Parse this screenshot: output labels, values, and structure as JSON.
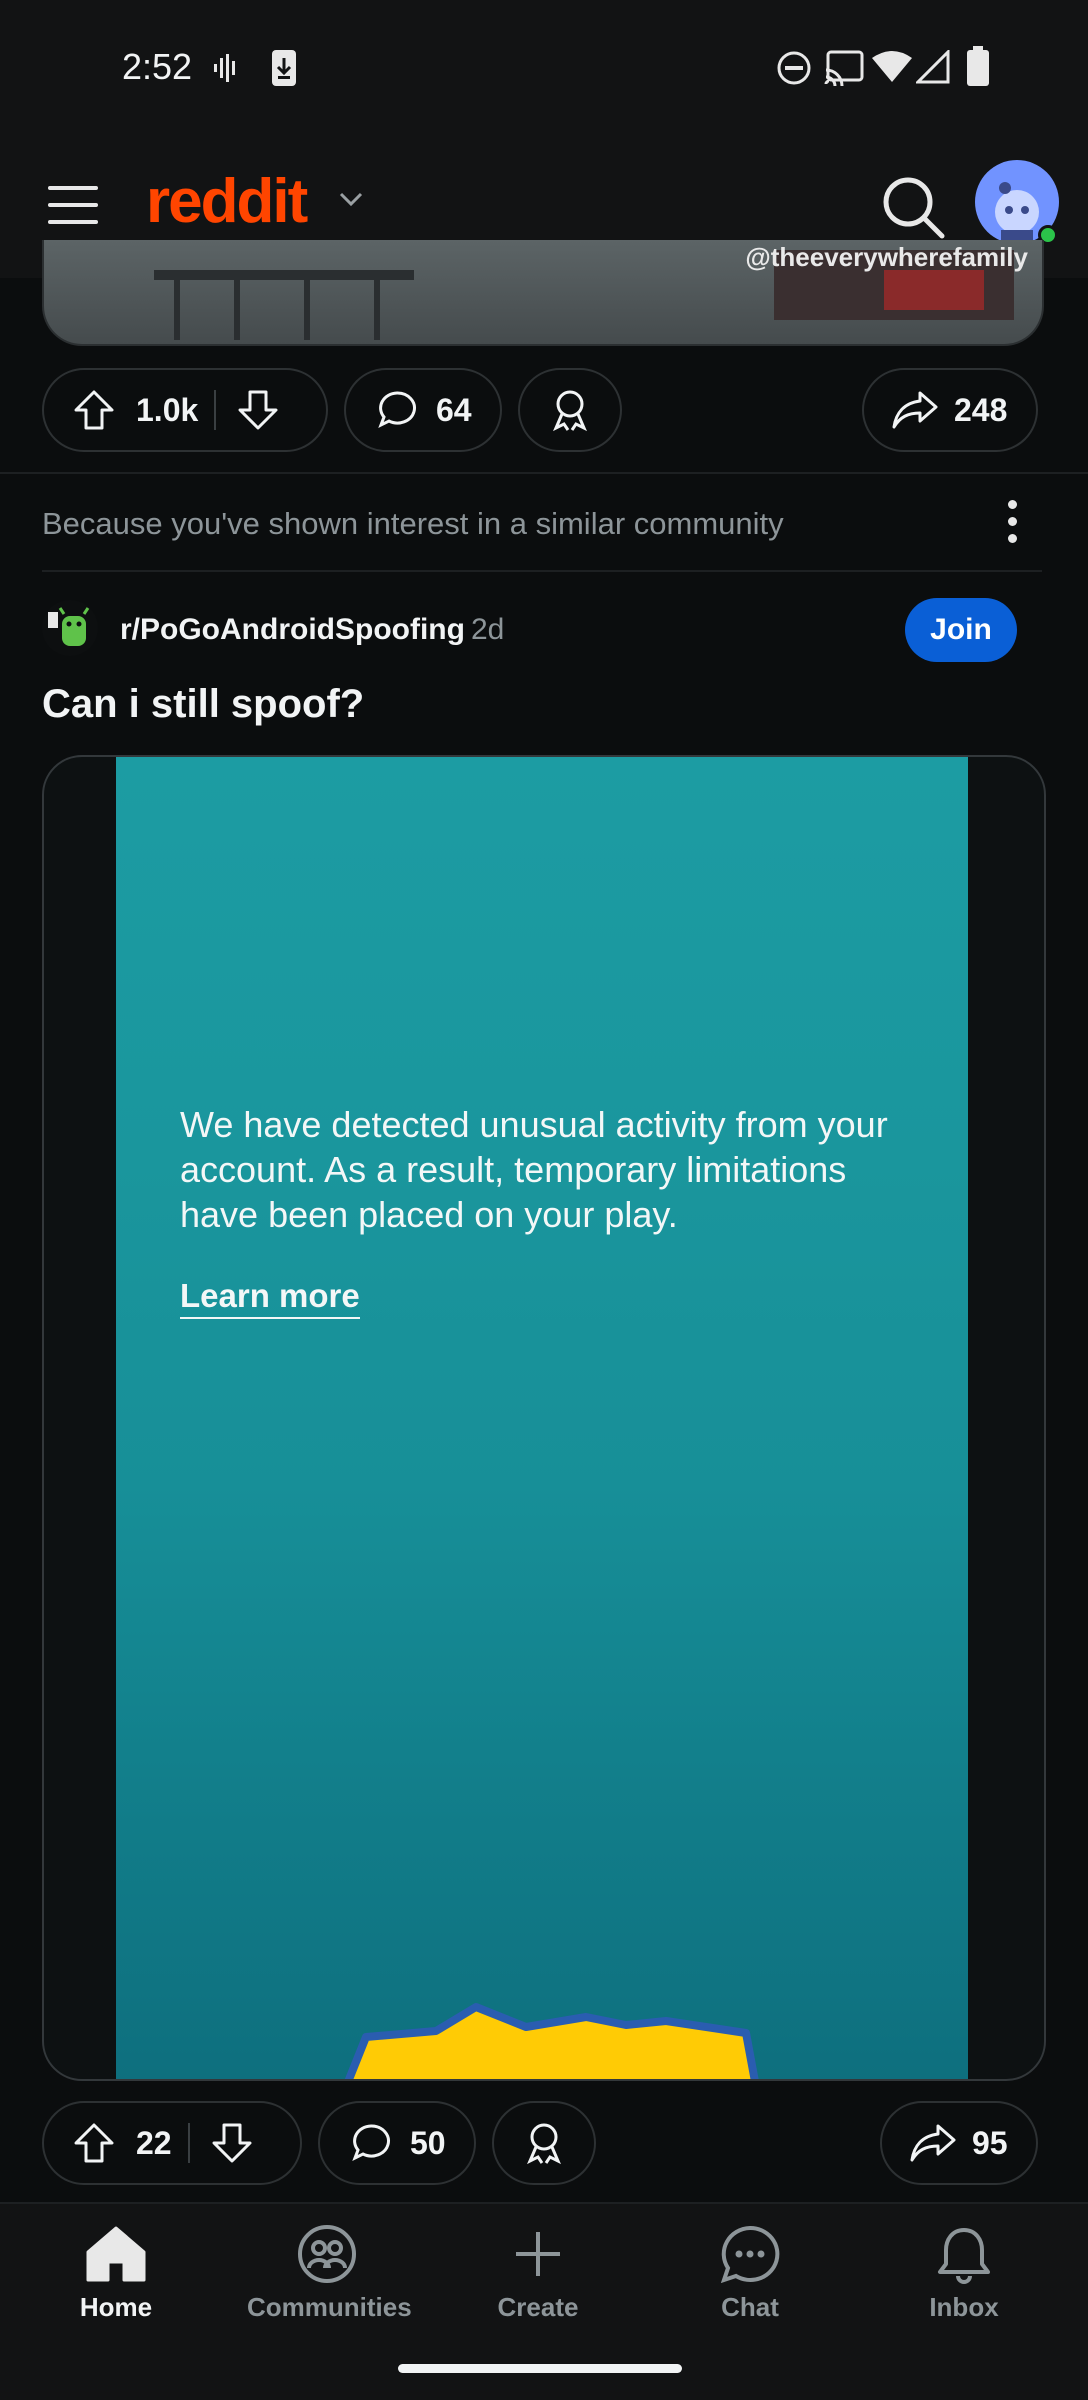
{
  "status_bar": {
    "time": "2:52",
    "icons": [
      "voicemail-icon",
      "download-icon",
      "do-not-disturb-icon",
      "cast-icon",
      "wifi-icon",
      "signal-icon",
      "battery-icon"
    ]
  },
  "header": {
    "logo_text": "reddit",
    "icons": [
      "menu-icon",
      "chevron-down-icon",
      "search-icon",
      "avatar"
    ]
  },
  "previous_post": {
    "watermark": "@theeverywherefamily",
    "upvotes": "1.0k",
    "comments": "64",
    "shares": "248"
  },
  "recommendation": {
    "reason": "Because you've shown interest in a similar community"
  },
  "post": {
    "subreddit": "r/PoGoAndroidSpoofing",
    "age": "2d",
    "join_label": "Join",
    "title": "Can i still spoof?",
    "video_message": "We have detected unusual activity from your account. As a result, temporary limitations have been placed on your play.",
    "video_link": "Learn more",
    "upvotes": "22",
    "comments": "50",
    "shares": "95"
  },
  "bottom_nav": {
    "items": [
      {
        "label": "Home",
        "icon": "home-icon",
        "active": true
      },
      {
        "label": "Communities",
        "icon": "communities-icon",
        "active": false
      },
      {
        "label": "Create",
        "icon": "plus-icon",
        "active": false
      },
      {
        "label": "Chat",
        "icon": "chat-icon",
        "active": false
      },
      {
        "label": "Inbox",
        "icon": "bell-icon",
        "active": false
      }
    ]
  },
  "colors": {
    "brand": "#ff4500",
    "join_button": "#0a5fd6",
    "background": "#0b0d0e",
    "online": "#2bc44a"
  }
}
